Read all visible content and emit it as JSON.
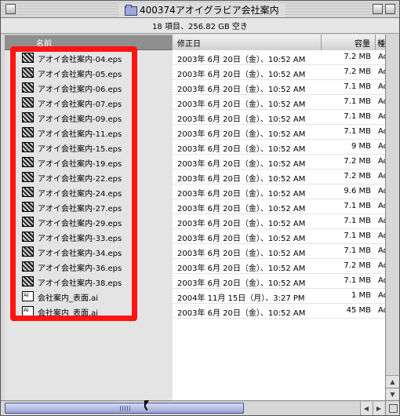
{
  "window": {
    "title": "400374アオイグラビア会社案内",
    "status": "18 項目、256.82 GB 空き"
  },
  "columns": {
    "name": "名前",
    "date": "修正日",
    "size": "容量",
    "kind": "種類"
  },
  "files": [
    {
      "name": "アオイ会社案内-04.eps",
      "date": "2003年 6月 20日（金）、10:52 AM",
      "size": "7.2 MB",
      "kind": "Ad",
      "icon": "eps-thumbnail-icon"
    },
    {
      "name": "アオイ会社案内-05.eps",
      "date": "2003年 6月 20日（金）、10:52 AM",
      "size": "7.2 MB",
      "kind": "Ad",
      "icon": "eps-thumbnail-icon"
    },
    {
      "name": "アオイ会社案内-06.eps",
      "date": "2003年 6月 20日（金）、10:52 AM",
      "size": "7.1 MB",
      "kind": "Ad",
      "icon": "eps-thumbnail-icon"
    },
    {
      "name": "アオイ会社案内-07.eps",
      "date": "2003年 6月 20日（金）、10:52 AM",
      "size": "7.1 MB",
      "kind": "Ad",
      "icon": "eps-thumbnail-icon"
    },
    {
      "name": "アオイ会社案内-09.eps",
      "date": "2003年 6月 20日（金）、10:52 AM",
      "size": "7.1 MB",
      "kind": "Ad",
      "icon": "eps-thumbnail-icon"
    },
    {
      "name": "アオイ会社案内-11.eps",
      "date": "2003年 6月 20日（金）、10:52 AM",
      "size": "7.1 MB",
      "kind": "Ad",
      "icon": "eps-thumbnail-icon"
    },
    {
      "name": "アオイ会社案内-15.eps",
      "date": "2003年 6月 20日（金）、10:52 AM",
      "size": "9 MB",
      "kind": "Ad",
      "icon": "eps-thumbnail-icon"
    },
    {
      "name": "アオイ会社案内-19.eps",
      "date": "2003年 6月 20日（金）、10:52 AM",
      "size": "7.2 MB",
      "kind": "Ad",
      "icon": "eps-thumbnail-icon"
    },
    {
      "name": "アオイ会社案内-22.eps",
      "date": "2003年 6月 20日（金）、10:52 AM",
      "size": "7.2 MB",
      "kind": "Ad",
      "icon": "eps-thumbnail-icon"
    },
    {
      "name": "アオイ会社案内-24.eps",
      "date": "2003年 6月 20日（金）、10:52 AM",
      "size": "9.6 MB",
      "kind": "Ad",
      "icon": "eps-thumbnail-icon"
    },
    {
      "name": "アオイ会社案内-27.eps",
      "date": "2003年 6月 20日（金）、10:52 AM",
      "size": "7.1 MB",
      "kind": "Ad",
      "icon": "eps-thumbnail-icon"
    },
    {
      "name": "アオイ会社案内-29.eps",
      "date": "2003年 6月 20日（金）、10:52 AM",
      "size": "7.1 MB",
      "kind": "Ad",
      "icon": "eps-thumbnail-icon"
    },
    {
      "name": "アオイ会社案内-33.eps",
      "date": "2003年 6月 20日（金）、10:52 AM",
      "size": "7.1 MB",
      "kind": "Ad",
      "icon": "eps-thumbnail-icon"
    },
    {
      "name": "アオイ会社案内-34.eps",
      "date": "2003年 6月 20日（金）、10:52 AM",
      "size": "7.1 MB",
      "kind": "Ad",
      "icon": "eps-thumbnail-icon"
    },
    {
      "name": "アオイ会社案内-36.eps",
      "date": "2003年 6月 20日（金）、10:52 AM",
      "size": "7.2 MB",
      "kind": "Ad",
      "icon": "eps-thumbnail-icon"
    },
    {
      "name": "アオイ会社案内-38.eps",
      "date": "2003年 6月 20日（金）、10:52 AM",
      "size": "7.1 MB",
      "kind": "Ad",
      "icon": "eps-thumbnail-icon"
    },
    {
      "name": "会社案内_表面.ai",
      "date": "2004年 11月 15日（月）、3:27 PM",
      "size": "1 MB",
      "kind": "Ad",
      "icon": "illustrator-file-icon"
    },
    {
      "name": "会社案内_表面.ai",
      "date": "2003年 6月 20日（金）、10:52 AM",
      "size": "45 MB",
      "kind": "Ad",
      "icon": "illustrator-file-icon"
    }
  ],
  "colors": {
    "highlight": "#ff1414",
    "scroll_thumb": "#9aa3d6",
    "folder": "#9fa8d8"
  }
}
